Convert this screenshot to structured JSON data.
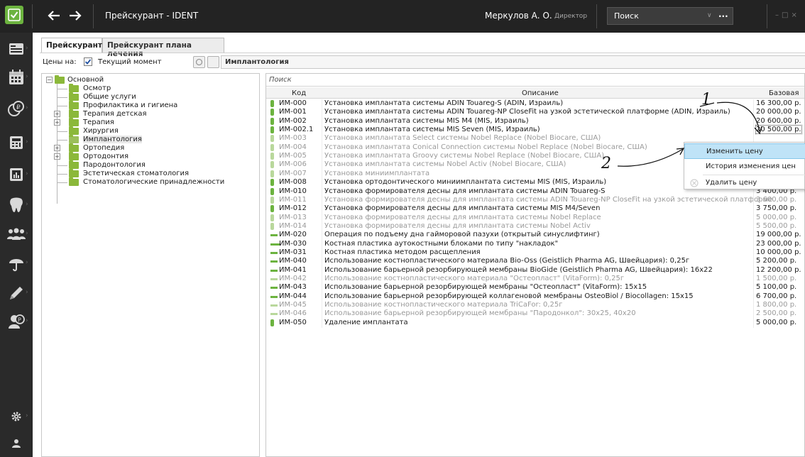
{
  "titlebar": {
    "app_title": "Прейскурант - IDENT",
    "user_name": "Меркулов А. О.",
    "user_role": "Директор",
    "search_label": "Поиск",
    "search_more": "...",
    "back_icon": "arrow-left-icon",
    "forward_icon": "arrow-right-icon"
  },
  "sidebar": {
    "items": [
      {
        "icon": "id-card-icon"
      },
      {
        "icon": "calendar-icon"
      },
      {
        "icon": "coins-icon"
      },
      {
        "icon": "cash-register-icon"
      },
      {
        "icon": "report-chart-icon"
      },
      {
        "icon": "tooth-icon"
      },
      {
        "icon": "people-icon"
      },
      {
        "icon": "umbrella-icon"
      },
      {
        "icon": "pen-icon"
      },
      {
        "icon": "person-coin-icon"
      },
      {
        "icon": "gear-icon"
      },
      {
        "icon": "user-icon"
      }
    ]
  },
  "tabs": [
    {
      "label": "Прейскурант",
      "active": true
    },
    {
      "label": "Прейскурант плана лечения",
      "active": false
    }
  ],
  "filter": {
    "prices_on_label": "Цены на:",
    "current_moment_checked": true,
    "current_moment_label": "Текущий момент",
    "category_value": "Имплантология"
  },
  "tree": {
    "root": "Основной",
    "nodes": [
      {
        "label": "Осмотр",
        "expandable": false
      },
      {
        "label": "Общие услуги",
        "expandable": false
      },
      {
        "label": "Профилактика и гигиена",
        "expandable": false
      },
      {
        "label": "Терапия детская",
        "expandable": true
      },
      {
        "label": "Терапия",
        "expandable": true
      },
      {
        "label": "Хирургия",
        "expandable": false
      },
      {
        "label": "Имплантология",
        "expandable": false,
        "selected": true
      },
      {
        "label": "Ортопедия",
        "expandable": true
      },
      {
        "label": "Ортодонтия",
        "expandable": true
      },
      {
        "label": "Пародонтология",
        "expandable": false
      },
      {
        "label": "Эстетическая стоматология",
        "expandable": false
      },
      {
        "label": "Стоматологические принадлежности",
        "expandable": false
      }
    ]
  },
  "grid": {
    "search_placeholder": "Поиск",
    "columns": {
      "code": "Код",
      "description": "Описание",
      "base": "Базовая"
    },
    "rows": [
      {
        "ind": "vbar",
        "active": true,
        "code": "ИМ-000",
        "desc": "Установка имплантата системы ADIN Touareg-S (ADIN, Израиль)",
        "price": "16 300,00 р."
      },
      {
        "ind": "vbar",
        "active": true,
        "code": "ИМ-001",
        "desc": "Установка имплантата системы ADIN Touareg-NP CloseFit на узкой эстетической платформе (ADIN, Израиль)",
        "price": "20 000,00 р."
      },
      {
        "ind": "vbar",
        "active": true,
        "code": "ИМ-002",
        "desc": "Установка имплантата системы MIS M4 (MIS, Израиль)",
        "price": "20 600,00 р."
      },
      {
        "ind": "vbar",
        "active": true,
        "code": "ИМ-002.1",
        "desc": "Установка имплантата системы MIS Seven (MIS, Израиль)",
        "price": "20 500,00 р.",
        "selected": true
      },
      {
        "ind": "vbar",
        "active": false,
        "code": "ИМ-003",
        "desc": "Установка имплантата Select системы Nobel Replace (Nobel Biocare, США)",
        "price": ""
      },
      {
        "ind": "vbar",
        "active": false,
        "code": "ИМ-004",
        "desc": "Установка имплантата Conical Connection системы Nobel Replace (Nobel Biocare, США)",
        "price": ""
      },
      {
        "ind": "vbar",
        "active": false,
        "code": "ИМ-005",
        "desc": "Установка имплантата Groovy системы Nobel Replace (Nobel Biocare, США)",
        "price": ""
      },
      {
        "ind": "vbar",
        "active": false,
        "code": "ИМ-006",
        "desc": "Установка имплантата системы Nobel Activ (Nobel Biocare, США)",
        "price": ""
      },
      {
        "ind": "vbar",
        "active": false,
        "code": "ИМ-007",
        "desc": "Установка миниимплантата",
        "price": "7 500,00 р."
      },
      {
        "ind": "vbar",
        "active": true,
        "code": "ИМ-008",
        "desc": "Установка ортодонтического миниимплантата системы MIS (MIS, Израиль)",
        "price": "10 500,00 р."
      },
      {
        "ind": "vbar",
        "active": true,
        "code": "ИМ-010",
        "desc": "Установка формирователя десны для имплантата системы ADIN Touareg-S",
        "price": "3 400,00 р."
      },
      {
        "ind": "vbar",
        "active": false,
        "code": "ИМ-011",
        "desc": "Установка формирователя десны для имплантата системы ADIN Touareg-NP CloseFit на узкой эстетической платформе",
        "price": "3 600,00 р."
      },
      {
        "ind": "vbar",
        "active": true,
        "code": "ИМ-012",
        "desc": "Установка формирователя десны для имплантата системы MIS M4/Seven",
        "price": "3 750,00 р."
      },
      {
        "ind": "vbar",
        "active": false,
        "code": "ИМ-013",
        "desc": "Установка формирователя десны для имплантата системы Nobel Replace",
        "price": "5 000,00 р."
      },
      {
        "ind": "vbar",
        "active": false,
        "code": "ИМ-014",
        "desc": "Установка формирователя десны для имплантата системы Nobel Activ",
        "price": "5 500,00 р."
      },
      {
        "ind": "hbar",
        "active": true,
        "code": "ИМ-020",
        "desc": "Операция по подъему дна гайморовой пазухи (открытый синуслифтинг)",
        "price": "19 000,00 р."
      },
      {
        "ind": "hbar2",
        "active": true,
        "code": "ИМ-030",
        "desc": "Костная пластика аутокостными блоками по типу \"накладок\"",
        "price": "23 000,00 р."
      },
      {
        "ind": "hbar",
        "active": true,
        "code": "ИМ-031",
        "desc": "Костная пластика методом расщепления",
        "price": "10 000,00 р."
      },
      {
        "ind": "hbar",
        "active": true,
        "code": "ИМ-040",
        "desc": "Использование костнопластического материала Bio-Oss (Geistlich Pharma AG, Швейцария): 0,25г",
        "price": "5 200,00 р."
      },
      {
        "ind": "hbar",
        "active": true,
        "code": "ИМ-041",
        "desc": "Использование барьерной резорбирующей мембраны BioGide (Geistlich Pharma AG, Швейцария): 16x22",
        "price": "12 200,00 р."
      },
      {
        "ind": "hbar",
        "active": false,
        "code": "ИМ-042",
        "desc": "Использование костнопластического материала \"Остеопласт\" (VitaForm): 0,25г",
        "price": "1 500,00 р."
      },
      {
        "ind": "hbar",
        "active": true,
        "code": "ИМ-043",
        "desc": "Использование барьерной резорбирующей мембраны \"Остеопласт\" (VitaForm): 15x15",
        "price": "5 100,00 р."
      },
      {
        "ind": "hbar",
        "active": true,
        "code": "ИМ-044",
        "desc": "Использование барьерной резорбирующей коллагеновой мембраны OsteoBiol / Biocollagen: 15x15",
        "price": "6 700,00 р."
      },
      {
        "ind": "hbar",
        "active": false,
        "code": "ИМ-045",
        "desc": "Использование костнопластического материала TriCaFor: 0,25г",
        "price": "1 800,00 р."
      },
      {
        "ind": "hbar",
        "active": false,
        "code": "ИМ-046",
        "desc": "Использование барьерной резорбирующей мембраны \"Пародонкол\": 30x25, 40x20",
        "price": "2 500,00 р."
      },
      {
        "ind": "vbar",
        "active": true,
        "code": "ИМ-050",
        "desc": "Удаление имплантата",
        "price": "5 000,00 р."
      }
    ]
  },
  "context_menu": {
    "items": [
      {
        "label": "Изменить цену",
        "highlighted": true,
        "icon": ""
      },
      {
        "label": "История изменения цен",
        "highlighted": false,
        "icon": ""
      },
      {
        "label": "Удалить цену",
        "highlighted": false,
        "icon": "delete-icon"
      }
    ]
  },
  "annotations": {
    "marker_1": "1",
    "marker_2": "2"
  },
  "colors": {
    "accent_green": "#6cb33f",
    "titlebar_bg": "#232323",
    "sidebar_bg": "#2a2a2a",
    "menu_highlight": "#bfe3f7"
  }
}
